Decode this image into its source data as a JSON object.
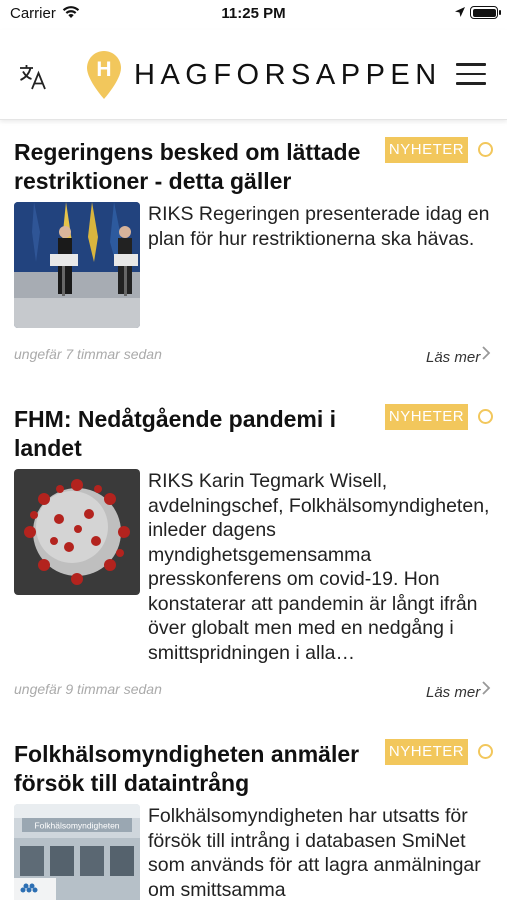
{
  "status_bar": {
    "carrier": "Carrier",
    "time": "11:25 PM",
    "battery_level": 1.0
  },
  "header": {
    "brand": "HAGFORSAPPEN",
    "logo_letter": "H",
    "translate_icon": "translate-icon",
    "menu_icon": "hamburger-menu-icon"
  },
  "colors": {
    "accent": "#f2c75c",
    "muted_text": "#aaaaaa"
  },
  "articles": [
    {
      "title": "Regeringens besked om lättade restriktioner - detta gäller",
      "category": "NYHETER",
      "excerpt": "RIKS Regeringen presenterade idag en plan för hur restriktionerna ska hävas.",
      "time_ago": "ungefär 7 timmar sedan",
      "read_more": "Läs mer",
      "thumbnail": "press-conference-photo"
    },
    {
      "title": "FHM: Nedåtgående pandemi i landet",
      "category": "NYHETER",
      "excerpt": "RIKS Karin Tegmark Wisell, avdelningschef, Folkhälsomyndigheten, inleder dagens myndighetsgemensamma presskonferens om covid-19. Hon konstaterar att pandemin är långt ifrån över globalt men med en nedgång i smittspridningen i alla…",
      "time_ago": "ungefär 9 timmar sedan",
      "read_more": "Läs mer",
      "thumbnail": "coronavirus-illustration"
    },
    {
      "title": "Folkhälsomyndigheten anmäler försök till dataintrång",
      "category": "NYHETER",
      "excerpt": "Folkhälsomyndigheten har utsatts för försök till intrång i databasen SmiNet som används för att lagra anmälningar om smittsamma",
      "thumbnail": "agency-building-photo",
      "thumbnail_sign": "Folkhälsomyndigheten"
    }
  ]
}
